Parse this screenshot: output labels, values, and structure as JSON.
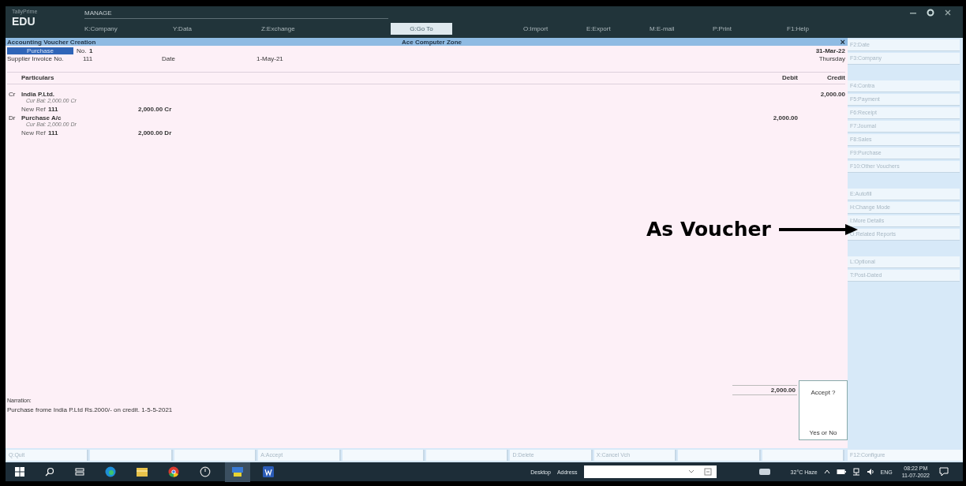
{
  "brand": {
    "product": "TallyPrime",
    "edition": "EDU",
    "section": "MANAGE"
  },
  "menu": [
    {
      "label": "K:Company",
      "kind": "text"
    },
    {
      "label": "Y:Data",
      "kind": "text"
    },
    {
      "label": "Z:Exchange",
      "kind": "text"
    },
    {
      "label": "G:Go To",
      "kind": "box"
    },
    {
      "label": "O:Import",
      "kind": "text"
    },
    {
      "label": "E:Export",
      "kind": "text"
    },
    {
      "label": "M:E-mail",
      "kind": "text"
    },
    {
      "label": "P:Print",
      "kind": "text"
    },
    {
      "label": "F1:Help",
      "kind": "text"
    }
  ],
  "voucher": {
    "title": "Accounting Voucher Creation",
    "company": "Ace Computer Zone",
    "close": "×",
    "type": "Purchase",
    "no_label": "No.",
    "no": "1",
    "date": "31-Mar-22",
    "day": "Thursday",
    "invoice_label": "Supplier Invoice No.",
    "invoice_no": "111",
    "date_label": "Date",
    "invoice_date": "1-May-21",
    "columns": [
      "Particulars",
      "Debit",
      "Credit"
    ],
    "entries": [
      {
        "side": "Cr",
        "ledger": "India P.Ltd.",
        "balance": "Cur Bal: 2,000.00 Cr",
        "ref_label": "New Ref",
        "ref": "111",
        "ref_amount": "2,000.00 Cr",
        "credit": "2,000.00"
      },
      {
        "side": "Dr",
        "ledger": "Purchase A/c",
        "balance": "Cur Bal: 2,000.00 Dr",
        "ref_label": "New Ref",
        "ref": "111",
        "ref_amount": "2,000.00 Dr",
        "debit": "2,000.00"
      }
    ],
    "narration_label": "Narration:",
    "narration": "Purchase frome India P.Ltd Rs.2000/- on credit. 1-5-5-2021",
    "total": "2,000.00"
  },
  "accept_dialog": {
    "question": "Accept ?",
    "answer": "Yes or No"
  },
  "side_panel": [
    {
      "kind": "button",
      "label": "F2:Date"
    },
    {
      "kind": "button",
      "label": "F3:Company"
    },
    {
      "kind": "gap"
    },
    {
      "kind": "button",
      "label": "F4:Contra"
    },
    {
      "kind": "button",
      "label": "F5:Payment"
    },
    {
      "kind": "button",
      "label": "F6:Receipt"
    },
    {
      "kind": "button",
      "label": "F7:Journal"
    },
    {
      "kind": "button",
      "label": "F8:Sales"
    },
    {
      "kind": "button",
      "label": "F9:Purchase"
    },
    {
      "kind": "button",
      "label": "F10:Other Vouchers"
    },
    {
      "kind": "gap"
    },
    {
      "kind": "button",
      "label": "E:Autofill"
    },
    {
      "kind": "button",
      "label": "H:Change Mode"
    },
    {
      "kind": "button",
      "label": "I:More Details"
    },
    {
      "kind": "button",
      "label": "O:Related Reports"
    },
    {
      "kind": "gap"
    },
    {
      "kind": "button",
      "label": "L:Optional"
    },
    {
      "kind": "button",
      "label": "T:Post-Dated"
    }
  ],
  "bottom_bar": [
    {
      "kind": "button",
      "label": "Q:Quit"
    },
    {
      "kind": "empty"
    },
    {
      "kind": "empty"
    },
    {
      "kind": "button",
      "label": "A:Accept"
    },
    {
      "kind": "empty"
    },
    {
      "kind": "empty"
    },
    {
      "kind": "button",
      "label": "D:Delete"
    },
    {
      "kind": "button",
      "label": "X:Cancel Vch"
    },
    {
      "kind": "empty"
    },
    {
      "kind": "empty"
    }
  ],
  "configure": "F12:Configure",
  "annotation": {
    "text": "As Voucher"
  },
  "taskbar": {
    "toolbar": "Desktop",
    "address_label": "Address",
    "weather": "32°C Haze",
    "language": "ENG",
    "time": "08:22 PM",
    "date": "11-07-2022"
  }
}
